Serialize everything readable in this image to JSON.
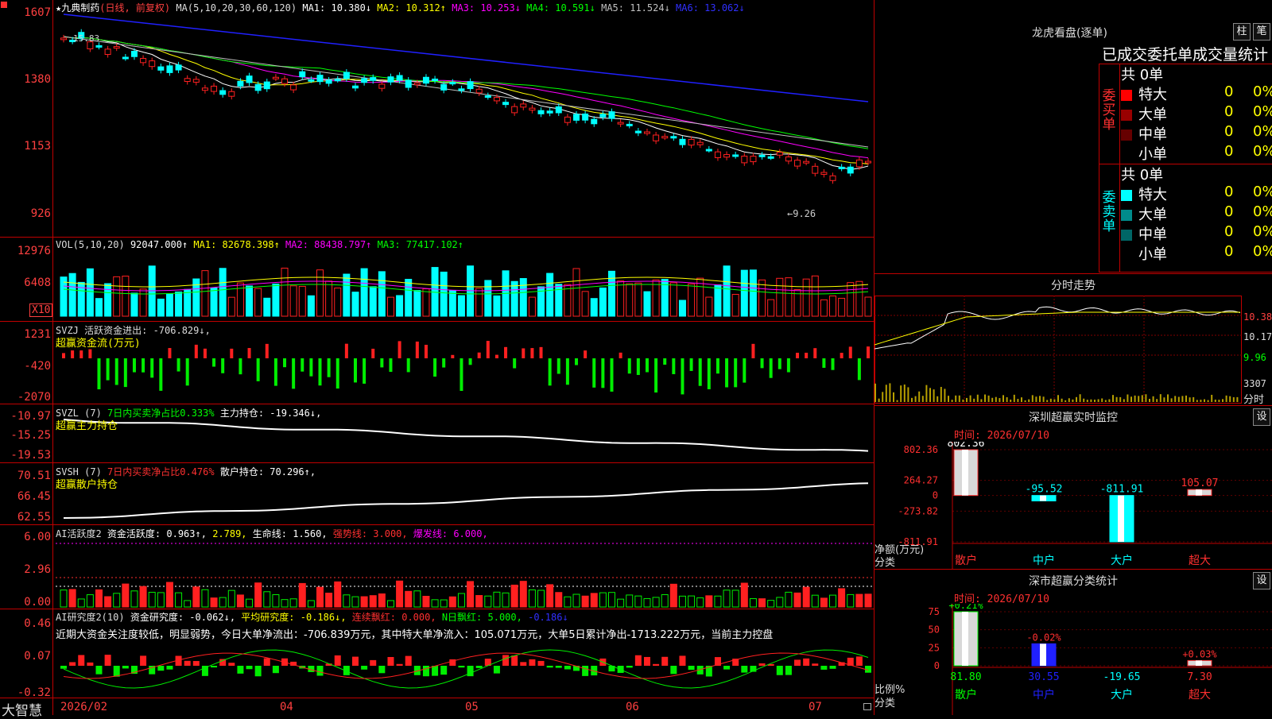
{
  "stock": {
    "name": "九典制药",
    "period_label": "(日线, 前复权)",
    "ma_params": "MA(5,10,20,30,60,120)",
    "ma_values": [
      "MA1: 10.380↓",
      "MA2: 10.312↑",
      "MA3: 10.253↓",
      "MA4: 10.591↓",
      "MA5: 11.524↓",
      "MA6: 13.062↓"
    ],
    "y_labels": [
      "1607",
      "1380",
      "1153",
      "926"
    ],
    "high_marker": "15.83",
    "low_marker": "←9.26"
  },
  "vol": {
    "params": "VOL(5,10,20)",
    "value": "92047.000↑",
    "ma1": "MA1: 82678.398↑",
    "ma2": "MA2: 88438.797↑",
    "ma3": "MA3: 77417.102↑",
    "y_labels": [
      "12976",
      "6408"
    ],
    "unit": "X10"
  },
  "svzj": {
    "line1": "SVZJ  活跃资金进出: -706.829↓,",
    "line2": "超赢资金流(万元)",
    "y_labels": [
      "1231",
      "-420",
      "-2070"
    ]
  },
  "svzl": {
    "prefix": "SVZL (7)",
    "net_ratio": "7日内买卖净占比0.333%",
    "holding": "主力持仓: -19.346↓,",
    "line2": "超赢主力持仓",
    "y_labels": [
      "-10.97",
      "-15.25",
      "-19.53"
    ]
  },
  "svsh": {
    "prefix": "SVSH (7)",
    "net_ratio": "7日内买卖净占比0.476%",
    "holding": "散户持仓: 70.296↑,",
    "line2": "超赢散户持仓",
    "y_labels": [
      "70.51",
      "66.45",
      "62.55"
    ]
  },
  "ai_active": {
    "prefix": "AI活跃度2",
    "fund_activity": "资金活跃度: 0.963↑,",
    "v2": "2.789,",
    "life_line": "生命线: 1.560,",
    "strong_line": "强势线: 3.000,",
    "burst_line": "爆发线: 6.000,",
    "y_labels": [
      "6.00",
      "2.96",
      "0.00"
    ]
  },
  "ai_research": {
    "prefix": "AI研究度2(10)",
    "research": "资金研究度: -0.062↓,",
    "avg": "平均研究度: -0.186↓,",
    "consec": "连续飘红: 0.000,",
    "nday": "N日飘红: 5.000,",
    "tail": "-0.186↓",
    "comment": "近期大资金关注度较低，明显弱势，今日大单净流出：-706.839万元，其中特大单净流入：105.071万元，大单5日累计净出-1713.222万元，当前主力控盘",
    "y_labels": [
      "0.46",
      "0.07",
      "-0.32"
    ]
  },
  "xaxis": {
    "labels": [
      "2026/02",
      "04",
      "05",
      "06",
      "07"
    ],
    "brand": "大智慧"
  },
  "dragon": {
    "title": "龙虎看盘(逐单)",
    "btn1": "柱",
    "btn2": "笔",
    "header": "已成交委托单成交量统计",
    "buy_label": "委买单",
    "sell_label": "委卖单",
    "buy_total": "共 0单",
    "sell_total": "共 0单",
    "buy_rows": [
      {
        "name": "特大",
        "count": "0",
        "pct": "0%",
        "color": "#ff0000"
      },
      {
        "name": "大单",
        "count": "0",
        "pct": "0%",
        "color": "#990000"
      },
      {
        "name": "中单",
        "count": "0",
        "pct": "0%",
        "color": "#660000"
      },
      {
        "name": "小单",
        "count": "0",
        "pct": "0%",
        "color": "#000000"
      }
    ],
    "sell_rows": [
      {
        "name": "特大",
        "count": "0",
        "pct": "0%",
        "color": "#00ffff"
      },
      {
        "name": "大单",
        "count": "0",
        "pct": "0%",
        "color": "#008b8b"
      },
      {
        "name": "中单",
        "count": "0",
        "pct": "0%",
        "color": "#006666"
      },
      {
        "name": "小单",
        "count": "0",
        "pct": "0%",
        "color": "#000000"
      }
    ]
  },
  "intraday": {
    "title": "分时走势",
    "y_labels": [
      "10.38",
      "10.17",
      "9.96"
    ],
    "vol_label": "3307",
    "mode_label": "分时"
  },
  "sz_monitor": {
    "title": "深圳超赢实时监控",
    "btn": "设",
    "time": "时间: 2026/07/10",
    "y_labels": [
      "802.36",
      "264.27",
      "0",
      "-273.82",
      "-811.91"
    ],
    "ylabel": "净额(万元)",
    "xlabel": "分类"
  },
  "sz_class": {
    "title": "深市超赢分类统计",
    "btn": "设",
    "time": "时间: 2026/07/10",
    "y_labels": [
      "75",
      "50",
      "25",
      "0"
    ],
    "ylabel": "比例%",
    "xlabel": "分类"
  },
  "chart_data": [
    {
      "type": "bar",
      "title": "深圳超赢实时监控",
      "ylabel": "净额(万元)",
      "categories": [
        "散户",
        "中户",
        "大户",
        "超大"
      ],
      "values": [
        802.36,
        -95.52,
        -811.91,
        105.07
      ],
      "value_labels": [
        "802.36",
        "-95.52",
        "-811.91",
        "105.07"
      ],
      "ylim": [
        -811.91,
        802.36
      ]
    },
    {
      "type": "bar",
      "title": "深市超赢分类统计",
      "ylabel": "比例%",
      "categories": [
        "散户",
        "中户",
        "大户",
        "超大"
      ],
      "values": [
        81.8,
        30.55,
        -19.65,
        7.3
      ],
      "value_labels": [
        "81.80",
        "30.55",
        "-19.65",
        "7.30"
      ],
      "change_labels": [
        "+0.21%",
        "-0.02%",
        "",
        "+0.03%"
      ],
      "ylim": [
        0,
        75
      ]
    }
  ]
}
